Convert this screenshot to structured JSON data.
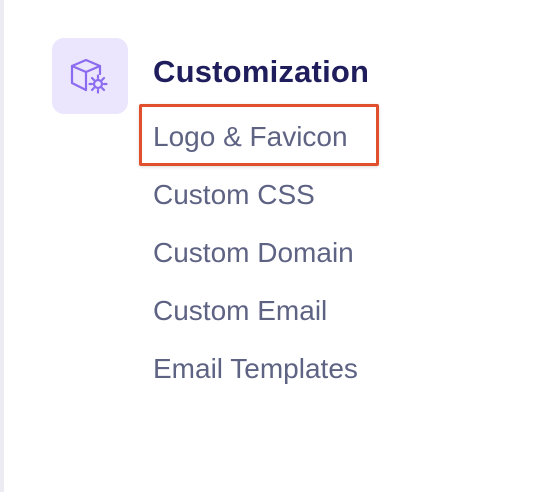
{
  "section": {
    "title": "Customization",
    "icon": "package-settings-icon",
    "icon_color": "#8b6cf0",
    "icon_bg": "#ebe5fd"
  },
  "menu": {
    "items": [
      {
        "label": "Logo & Favicon",
        "highlighted": true
      },
      {
        "label": "Custom CSS",
        "highlighted": false
      },
      {
        "label": "Custom Domain",
        "highlighted": false
      },
      {
        "label": "Custom Email",
        "highlighted": false
      },
      {
        "label": "Email Templates",
        "highlighted": false
      }
    ]
  },
  "colors": {
    "title": "#1f1d5c",
    "item": "#5e6383",
    "highlight_border": "#e0502d"
  }
}
